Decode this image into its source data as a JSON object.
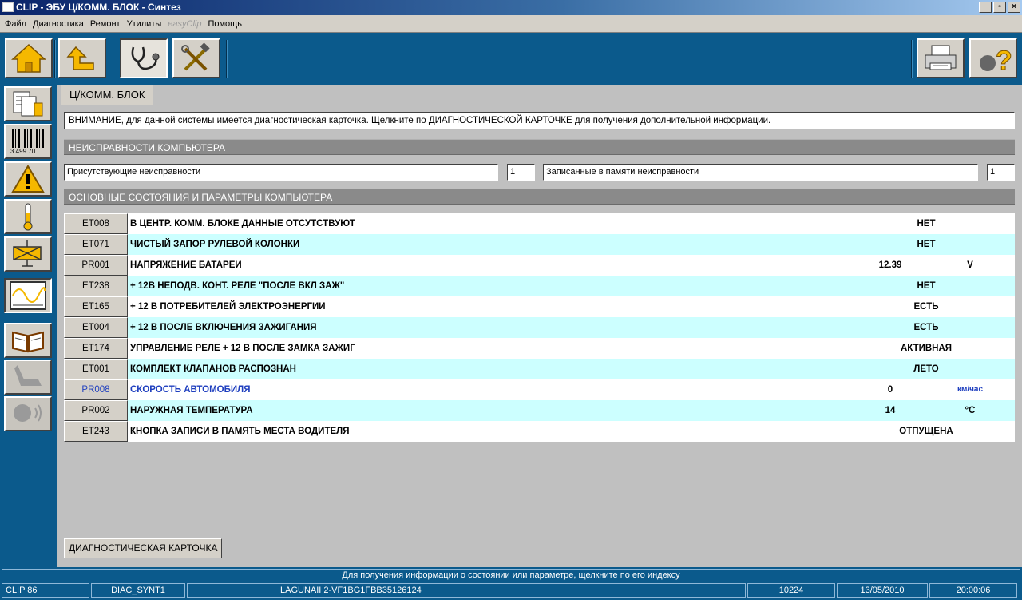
{
  "window": {
    "title": "CLIP - ЭБУ Ц/КОММ. БЛОК - Синтез",
    "btn_min": "_",
    "btn_restore": "▫",
    "btn_close": "×"
  },
  "menu": {
    "items": [
      "Файл",
      "Диагностика",
      "Ремонт",
      "Утилиты",
      "easyClip",
      "Помощь"
    ]
  },
  "toolbar": {
    "icons": [
      "home-icon",
      "up-arrow-icon",
      "stethoscope-icon",
      "tools-icon",
      "printer-icon",
      "help-icon"
    ]
  },
  "sidebar": {
    "icons": [
      "documents-icon",
      "barcode-icon",
      "warning-icon",
      "thermometer-icon",
      "actuator-icon",
      "oscilloscope-icon",
      "manual-book-icon",
      "seat-icon",
      "voice-icon"
    ],
    "barcode_text": "3 499 70"
  },
  "main": {
    "tab_label": "Ц/КОММ. БЛОК",
    "notice": "ВНИМАНИЕ, для данной системы имеется диагностическая карточка. Щелкните по ДИАГНОСТИЧЕСКОЙ КАРТОЧКЕ для получения дополнительной информации.",
    "faults_header": "НЕИСПРАВНОСТИ КОМПЬЮТЕРА",
    "present_faults_label": "Присутствующие неисправности",
    "present_faults_count": "1",
    "stored_faults_label": "Записанные в памяти неисправности",
    "stored_faults_count": "1",
    "params_header": "ОСНОВНЫЕ СОСТОЯНИЯ И ПАРАМЕТРЫ КОМПЬЮТЕРА",
    "diag_card_button": "ДИАГНОСТИЧЕСКАЯ КАРТОЧКА"
  },
  "params": [
    {
      "code": "ET008",
      "name": "В ЦЕНТР. КОММ. БЛОКЕ ДАННЫЕ ОТСУТСТВУЮТ",
      "state": "НЕТ"
    },
    {
      "code": "ET071",
      "name": "ЧИСТЫЙ ЗАПОР РУЛЕВОЙ КОЛОНКИ",
      "state": "НЕТ"
    },
    {
      "code": "PR001",
      "name": "НАПРЯЖЕНИЕ БАТАРЕИ",
      "value": "12.39",
      "unit": "V"
    },
    {
      "code": "ET238",
      "name": "+ 12В НЕПОДВ. КОНТ. РЕЛЕ \"ПОСЛЕ ВКЛ ЗАЖ\"",
      "state": "НЕТ"
    },
    {
      "code": "ET165",
      "name": "+ 12 В ПОТРЕБИТЕЛЕЙ ЭЛЕКТРОЭНЕРГИИ",
      "state": "ЕСТЬ"
    },
    {
      "code": "ET004",
      "name": "+ 12 В ПОСЛЕ ВКЛЮЧЕНИЯ ЗАЖИГАНИЯ",
      "state": "ЕСТЬ"
    },
    {
      "code": "ET174",
      "name": "УПРАВЛЕНИЕ РЕЛЕ + 12 В ПОСЛЕ ЗАМКА ЗАЖИГ",
      "state": "АКТИВНАЯ"
    },
    {
      "code": "ET001",
      "name": "КОМПЛЕКТ КЛАПАНОВ РАСПОЗНАН",
      "state": "ЛЕТО"
    },
    {
      "code": "PR008",
      "name": "СКОРОСТЬ АВТОМОБИЛЯ",
      "value": "0",
      "unit": "км/час",
      "link": true
    },
    {
      "code": "PR002",
      "name": "НАРУЖНАЯ ТЕМПЕРАТУРА",
      "value": "14",
      "unit": "°C"
    },
    {
      "code": "ET243",
      "name": "КНОПКА ЗАПИСИ В ПАМЯТЬ МЕСТА ВОДИТЕЛЯ",
      "state": "ОТПУЩЕНА"
    }
  ],
  "status": {
    "hint": "Для получения информации о состоянии или параметре, щелкните по его индексу",
    "cells": [
      "CLIP 86",
      "DIAC_SYNT1",
      "LAGUNAII 2-VF1BG1FBB35126124",
      "10224",
      "13/05/2010",
      "20:00:06"
    ]
  },
  "colors": {
    "background": "#0b5a8c",
    "row_alt": "#ccffff",
    "link": "#1f3fbf",
    "section_header": "#8a8a8a"
  }
}
